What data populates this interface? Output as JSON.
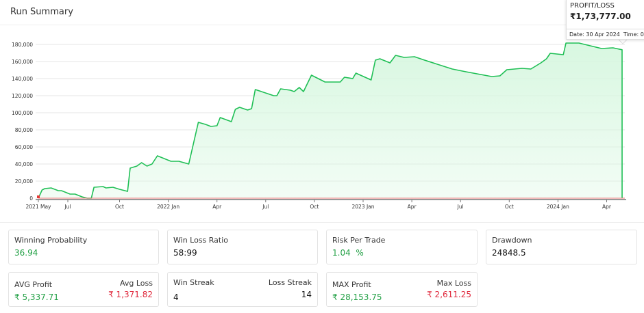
{
  "header": {
    "title": "Run Summary"
  },
  "tooltip": {
    "label": "PROFIT/LOSS",
    "value": "₹1,73,777.00",
    "date": "Date: 30 Apr 2024",
    "time": "Time: 0"
  },
  "colors": {
    "line": "#1fbf55",
    "fill": "#d6f7df",
    "positive": "#22a045",
    "negative": "#e0283c"
  },
  "chart_data": {
    "type": "area",
    "ylim": [
      0,
      180000
    ],
    "yticks": [
      "0",
      "20,000",
      "40,000",
      "60,000",
      "80,000",
      "100,000",
      "120,000",
      "140,000",
      "160,000",
      "180,000"
    ],
    "xticks": [
      "2021 May",
      "Jul",
      "Oct",
      "2022 Jan",
      "Apr",
      "Jul",
      "Oct",
      "2023 Jan",
      "Apr",
      "Jul",
      "Oct",
      "2024 Jan",
      "Apr"
    ],
    "grid": true,
    "points": [
      [
        "2021-05-01",
        0
      ],
      [
        "2021-05-08",
        9600
      ],
      [
        "2021-05-13",
        11200
      ],
      [
        "2021-05-25",
        12000
      ],
      [
        "2021-06-08",
        8800
      ],
      [
        "2021-06-14",
        8800
      ],
      [
        "2021-06-30",
        4800
      ],
      [
        "2021-07-09",
        4800
      ],
      [
        "2021-07-22",
        1600
      ],
      [
        "2021-08-01",
        0
      ],
      [
        "2021-08-09",
        0
      ],
      [
        "2021-08-14",
        12800
      ],
      [
        "2021-08-31",
        13600
      ],
      [
        "2021-09-06",
        12000
      ],
      [
        "2021-09-19",
        12800
      ],
      [
        "2021-10-01",
        10400
      ],
      [
        "2021-10-16",
        8000
      ],
      [
        "2021-10-21",
        35200
      ],
      [
        "2021-11-03",
        37600
      ],
      [
        "2021-11-12",
        41600
      ],
      [
        "2021-11-22",
        37600
      ],
      [
        "2021-12-01",
        40000
      ],
      [
        "2021-12-11",
        49600
      ],
      [
        "2022-01-06",
        43200
      ],
      [
        "2022-01-21",
        43200
      ],
      [
        "2022-02-09",
        40000
      ],
      [
        "2022-02-27",
        88800
      ],
      [
        "2022-03-10",
        86400
      ],
      [
        "2022-03-20",
        84000
      ],
      [
        "2022-04-01",
        84800
      ],
      [
        "2022-04-07",
        94400
      ],
      [
        "2022-04-28",
        89600
      ],
      [
        "2022-05-05",
        104000
      ],
      [
        "2022-05-13",
        106400
      ],
      [
        "2022-05-28",
        103200
      ],
      [
        "2022-06-05",
        104800
      ],
      [
        "2022-06-12",
        127200
      ],
      [
        "2022-07-16",
        120000
      ],
      [
        "2022-07-22",
        120000
      ],
      [
        "2022-07-29",
        128000
      ],
      [
        "2022-08-17",
        126400
      ],
      [
        "2022-08-24",
        124800
      ],
      [
        "2022-09-03",
        129600
      ],
      [
        "2022-09-11",
        124800
      ],
      [
        "2022-09-26",
        144000
      ],
      [
        "2022-10-21",
        136000
      ],
      [
        "2022-11-19",
        136000
      ],
      [
        "2022-11-27",
        141600
      ],
      [
        "2022-12-12",
        140000
      ],
      [
        "2022-12-18",
        146400
      ],
      [
        "2023-01-16",
        138400
      ],
      [
        "2023-01-24",
        161600
      ],
      [
        "2023-02-02",
        163200
      ],
      [
        "2023-02-21",
        158400
      ],
      [
        "2023-03-01",
        167200
      ],
      [
        "2023-03-17",
        164800
      ],
      [
        "2023-04-06",
        165600
      ],
      [
        "2023-04-25",
        161600
      ],
      [
        "2023-06-16",
        151200
      ],
      [
        "2023-07-11",
        148000
      ],
      [
        "2023-08-29",
        142400
      ],
      [
        "2023-09-14",
        143200
      ],
      [
        "2023-09-27",
        150400
      ],
      [
        "2023-10-25",
        152000
      ],
      [
        "2023-11-11",
        151200
      ],
      [
        "2023-11-30",
        158400
      ],
      [
        "2023-12-10",
        163200
      ],
      [
        "2023-12-17",
        169600
      ],
      [
        "2024-01-11",
        168000
      ],
      [
        "2024-01-16",
        181600
      ],
      [
        "2024-02-10",
        181600
      ],
      [
        "2024-03-22",
        175200
      ],
      [
        "2024-04-13",
        176000
      ],
      [
        "2024-04-30",
        173777
      ]
    ]
  },
  "stats": {
    "winning_probability": {
      "label": "Winning Probability",
      "value": "36.94"
    },
    "win_loss_ratio": {
      "label": "Win Loss Ratio",
      "value": "58:99"
    },
    "risk_per_trade": {
      "label": "Risk Per Trade",
      "value": "1.04  %"
    },
    "drawdown": {
      "label": "Drawdown",
      "value": "24848.5"
    },
    "avg_profit": {
      "label": "AVG Profit",
      "value": "₹ 5,337.71"
    },
    "avg_loss": {
      "label": "Avg Loss",
      "value": "₹ 1,371.82"
    },
    "win_streak": {
      "label": "Win Streak",
      "value": "4"
    },
    "loss_streak": {
      "label": "Loss Streak",
      "value": "14"
    },
    "max_profit": {
      "label": "MAX Profit",
      "value": "₹ 28,153.75"
    },
    "max_loss": {
      "label": "Max Loss",
      "value": "₹ 2,611.25"
    }
  }
}
